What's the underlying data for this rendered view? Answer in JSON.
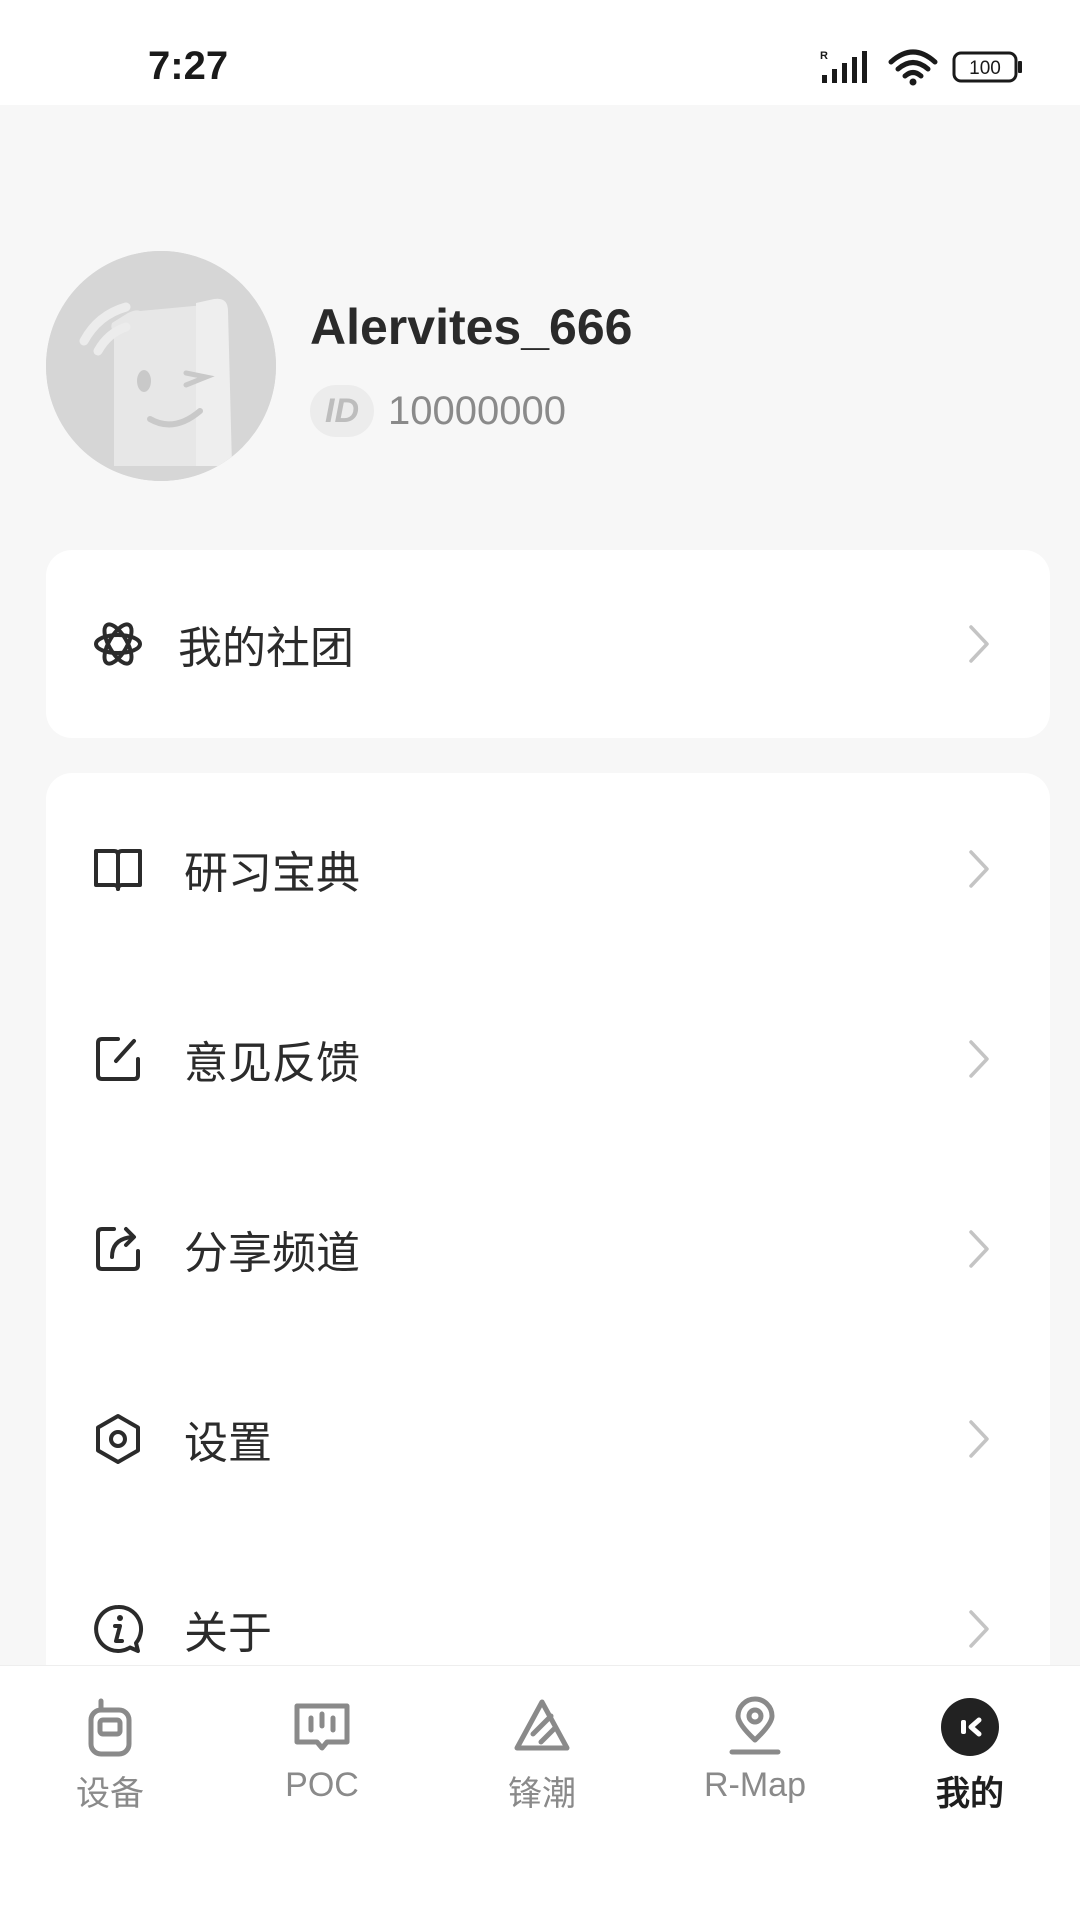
{
  "status_bar": {
    "time": "7:27",
    "battery": "100",
    "signal_label": "R"
  },
  "profile": {
    "username": "Alervites_666",
    "id_badge": "ID",
    "id_value": "10000000"
  },
  "menu_group_1": [
    {
      "label": "我的社团",
      "icon": "atom-icon"
    }
  ],
  "menu_group_2": [
    {
      "label": "研习宝典",
      "icon": "book-icon"
    },
    {
      "label": "意见反馈",
      "icon": "edit-icon"
    },
    {
      "label": "分享频道",
      "icon": "share-icon"
    },
    {
      "label": "设置",
      "icon": "settings-hexagon-icon"
    },
    {
      "label": "关于",
      "icon": "info-icon"
    }
  ],
  "bottom_nav": [
    {
      "label": "设备",
      "icon": "walkie-talkie-icon",
      "active": false
    },
    {
      "label": "POC",
      "icon": "poc-message-icon",
      "active": false
    },
    {
      "label": "锋潮",
      "icon": "triangle-logo-icon",
      "active": false
    },
    {
      "label": "R-Map",
      "icon": "map-pin-icon",
      "active": false
    },
    {
      "label": "我的",
      "icon": "profile-face-icon",
      "active": true
    }
  ],
  "colors": {
    "background": "#f7f7f7",
    "card": "#ffffff",
    "text_primary": "#2b2b2b",
    "text_secondary": "#8a8a8a",
    "active_nav": "#1e1e1e"
  }
}
